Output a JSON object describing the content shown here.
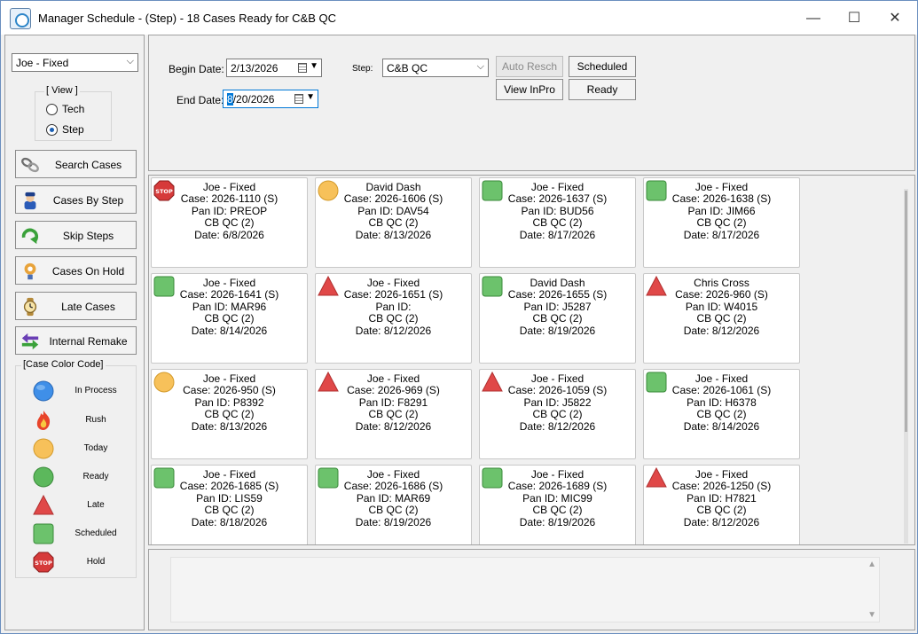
{
  "window": {
    "title": "Manager Schedule - (Step) - 18 Cases Ready for C&B QC",
    "minimize": "—",
    "maximize": "☐",
    "close": "✕"
  },
  "left": {
    "user_select": "Joe - Fixed",
    "view_legend": "[ View ]",
    "view_options": [
      {
        "label": "Tech",
        "selected": false
      },
      {
        "label": "Step",
        "selected": true
      }
    ],
    "buttons": [
      {
        "label": "Search Cases",
        "icon": "chain-link-icon"
      },
      {
        "label": "Cases By Step",
        "icon": "worker-icon"
      },
      {
        "label": "Skip Steps",
        "icon": "skip-arrow-icon"
      },
      {
        "label": "Cases On Hold",
        "icon": "trophy-icon"
      },
      {
        "label": "Late Cases",
        "icon": "watch-icon"
      },
      {
        "label": "Internal Remake",
        "icon": "swap-arrows-icon"
      }
    ],
    "color_legend": "[Case Color Code]",
    "color_codes": [
      {
        "label": "In Process",
        "icon": "in-process-icon",
        "color": "#3f8fe8"
      },
      {
        "label": "Rush",
        "icon": "flame-icon",
        "color": "#e8442a"
      },
      {
        "label": "Today",
        "icon": "today-icon",
        "color": "#f7c15a"
      },
      {
        "label": "Ready",
        "icon": "ready-icon",
        "color": "#5cb85c"
      },
      {
        "label": "Late",
        "icon": "late-icon",
        "color": "#e04848"
      },
      {
        "label": "Scheduled",
        "icon": "scheduled-icon",
        "color": "#6cc26c"
      },
      {
        "label": "Hold",
        "icon": "stop-icon",
        "color": "#d63a3a"
      }
    ]
  },
  "filters": {
    "begin_label": "Begin Date:",
    "begin_value": "2/13/2026",
    "end_label": "End Date:",
    "end_value_selected": "8",
    "end_value_rest": "/20/2026",
    "step_label": "Step:",
    "step_value": "C&B QC",
    "buttons": {
      "auto_resch": "Auto Resch",
      "scheduled": "Scheduled",
      "view_inpro": "View InPro",
      "ready": "Ready"
    }
  },
  "cards": [
    {
      "status": "hold",
      "name": "Joe - Fixed",
      "case": "Case: 2026-1110 (S)",
      "pan": "Pan ID: PREOP",
      "step": "CB QC (2)",
      "date": "Date: 6/8/2026"
    },
    {
      "status": "today",
      "name": "David Dash",
      "case": "Case: 2026-1606 (S)",
      "pan": "Pan ID: DAV54",
      "step": "CB QC (2)",
      "date": "Date: 8/13/2026"
    },
    {
      "status": "scheduled",
      "name": "Joe - Fixed",
      "case": "Case: 2026-1637 (S)",
      "pan": "Pan ID: BUD56",
      "step": "CB QC (2)",
      "date": "Date: 8/17/2026"
    },
    {
      "status": "scheduled",
      "name": "Joe - Fixed",
      "case": "Case: 2026-1638 (S)",
      "pan": "Pan ID: JIM66",
      "step": "CB QC (2)",
      "date": "Date: 8/17/2026"
    },
    {
      "status": "scheduled",
      "name": "Joe - Fixed",
      "case": "Case: 2026-1641 (S)",
      "pan": "Pan ID: MAR96",
      "step": "CB QC (2)",
      "date": "Date: 8/14/2026"
    },
    {
      "status": "late",
      "name": "Joe - Fixed",
      "case": "Case: 2026-1651 (S)",
      "pan": "Pan ID:",
      "step": "CB QC (2)",
      "date": "Date: 8/12/2026"
    },
    {
      "status": "scheduled",
      "name": "David Dash",
      "case": "Case: 2026-1655 (S)",
      "pan": "Pan ID: J5287",
      "step": "CB QC (2)",
      "date": "Date: 8/19/2026"
    },
    {
      "status": "late",
      "name": "Chris Cross",
      "case": "Case: 2026-960 (S)",
      "pan": "Pan ID: W4015",
      "step": "CB QC (2)",
      "date": "Date: 8/12/2026"
    },
    {
      "status": "today",
      "name": "Joe - Fixed",
      "case": "Case: 2026-950 (S)",
      "pan": "Pan ID: P8392",
      "step": "CB QC (2)",
      "date": "Date: 8/13/2026"
    },
    {
      "status": "late",
      "name": "Joe - Fixed",
      "case": "Case: 2026-969 (S)",
      "pan": "Pan ID: F8291",
      "step": "CB QC (2)",
      "date": "Date: 8/12/2026"
    },
    {
      "status": "late",
      "name": "Joe - Fixed",
      "case": "Case: 2026-1059 (S)",
      "pan": "Pan ID: J5822",
      "step": "CB QC (2)",
      "date": "Date: 8/12/2026"
    },
    {
      "status": "scheduled",
      "name": "Joe - Fixed",
      "case": "Case: 2026-1061 (S)",
      "pan": "Pan ID: H6378",
      "step": "CB QC (2)",
      "date": "Date: 8/14/2026"
    },
    {
      "status": "scheduled",
      "name": "Joe - Fixed",
      "case": "Case: 2026-1685 (S)",
      "pan": "Pan ID: LIS59",
      "step": "CB QC (2)",
      "date": "Date: 8/18/2026"
    },
    {
      "status": "scheduled",
      "name": "Joe - Fixed",
      "case": "Case: 2026-1686 (S)",
      "pan": "Pan ID: MAR69",
      "step": "CB QC (2)",
      "date": "Date: 8/19/2026"
    },
    {
      "status": "scheduled",
      "name": "Joe - Fixed",
      "case": "Case: 2026-1689 (S)",
      "pan": "Pan ID: MIC99",
      "step": "CB QC (2)",
      "date": "Date: 8/19/2026"
    },
    {
      "status": "late",
      "name": "Joe - Fixed",
      "case": "Case: 2026-1250 (S)",
      "pan": "Pan ID: H7821",
      "step": "CB QC (2)",
      "date": "Date: 8/12/2026"
    }
  ]
}
